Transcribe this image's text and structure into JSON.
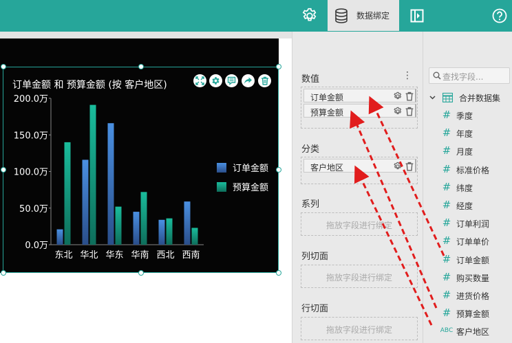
{
  "topbar": {
    "bind_tab_label": "数据绑定",
    "icons": [
      "gear-icon",
      "database-icon",
      "panel-toggle-icon",
      "help-icon"
    ],
    "color": "#26a69a"
  },
  "chart_tools": [
    "expand-icon",
    "settings-icon",
    "comment-icon",
    "share-icon",
    "trash-icon"
  ],
  "chart_data": {
    "type": "bar",
    "title": "订单金额 和 预算金额 (按 客户地区)",
    "categories": [
      "东北",
      "华北",
      "华东",
      "华南",
      "西北",
      "西南"
    ],
    "series": [
      {
        "name": "订单金额",
        "values": [
          210000,
          1160000,
          1660000,
          450000,
          340000,
          590000
        ],
        "color": "#4a90e2"
      },
      {
        "name": "预算金额",
        "values": [
          1400000,
          1910000,
          520000,
          720000,
          360000,
          230000
        ],
        "color": "#1abc9c"
      }
    ],
    "yticks": [
      "200.0万",
      "150.0万",
      "100.0万",
      "50.0万",
      "0.0万"
    ],
    "ylim": [
      0,
      2000000
    ],
    "legend": "right",
    "grid": false
  },
  "binding": {
    "values": {
      "title": "数值",
      "fields": [
        "订单金额",
        "预算金额"
      ]
    },
    "category": {
      "title": "分类",
      "fields": [
        "客户地区"
      ]
    },
    "series": {
      "title": "系列",
      "hint": "拖放字段进行绑定"
    },
    "col_facet": {
      "title": "列切面",
      "hint": "拖放字段进行绑定"
    },
    "row_facet": {
      "title": "行切面",
      "hint": "拖放字段进行绑定"
    },
    "more_label": "⋮"
  },
  "fields_panel": {
    "search_placeholder": "查找字段...",
    "dataset": "合并数据集",
    "fields": [
      {
        "type": "#",
        "name": "季度"
      },
      {
        "type": "#",
        "name": "年度"
      },
      {
        "type": "#",
        "name": "月度"
      },
      {
        "type": "#",
        "name": "标准价格"
      },
      {
        "type": "#",
        "name": "纬度"
      },
      {
        "type": "#",
        "name": "经度"
      },
      {
        "type": "#",
        "name": "订单利润"
      },
      {
        "type": "#",
        "name": "订单单价"
      },
      {
        "type": "#",
        "name": "订单金额"
      },
      {
        "type": "#",
        "name": "购买数量"
      },
      {
        "type": "#",
        "name": "进货价格"
      },
      {
        "type": "#",
        "name": "预算金额"
      },
      {
        "type": "ABC",
        "name": "客户地区"
      }
    ]
  }
}
